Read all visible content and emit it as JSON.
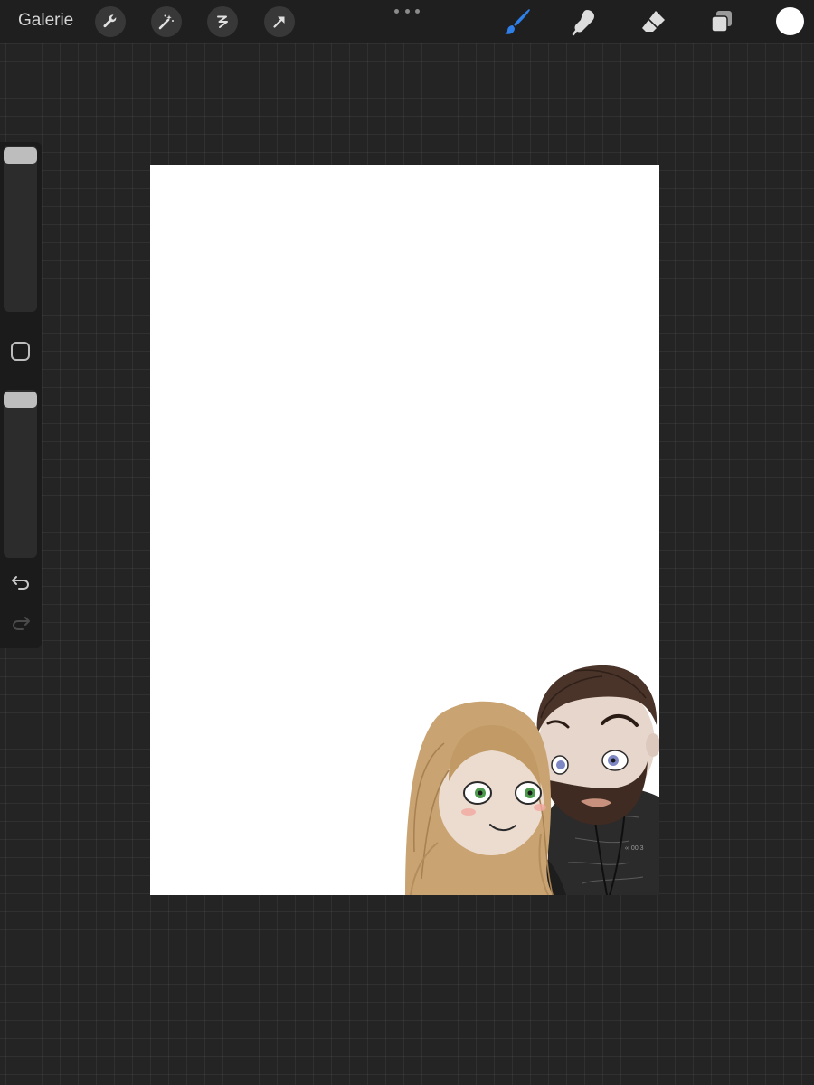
{
  "topbar": {
    "gallery_label": "Galerie",
    "tools_left": [
      {
        "name": "actions",
        "icon": "wrench-icon"
      },
      {
        "name": "adjustments",
        "icon": "magic-wand-icon"
      },
      {
        "name": "selection",
        "icon": "selection-s-icon"
      },
      {
        "name": "transform",
        "icon": "arrow-cursor-icon"
      }
    ],
    "more_icon": "more-dots-icon",
    "tools_right": [
      {
        "name": "brush",
        "icon": "brush-icon",
        "active": true
      },
      {
        "name": "smudge",
        "icon": "smudge-finger-icon",
        "active": false
      },
      {
        "name": "eraser",
        "icon": "eraser-icon",
        "active": false
      },
      {
        "name": "layers",
        "icon": "layers-icon",
        "active": false
      }
    ],
    "current_color": "#ffffff",
    "active_tool_color": "#2f7fe8"
  },
  "sidebar": {
    "brush_size_slider": {
      "value": 1.0
    },
    "opacity_slider": {
      "value": 1.0
    },
    "modify_icon": "square-modify-icon",
    "undo_icon": "undo-arrow-icon",
    "redo_icon": "redo-arrow-icon",
    "redo_enabled": false
  },
  "canvas": {
    "background": "#ffffff",
    "artwork": "couple-portrait-illustration"
  },
  "colors": {
    "app_background": "#242424",
    "topbar": "#1f1f1f",
    "sidebar": "#1b1b1b"
  }
}
